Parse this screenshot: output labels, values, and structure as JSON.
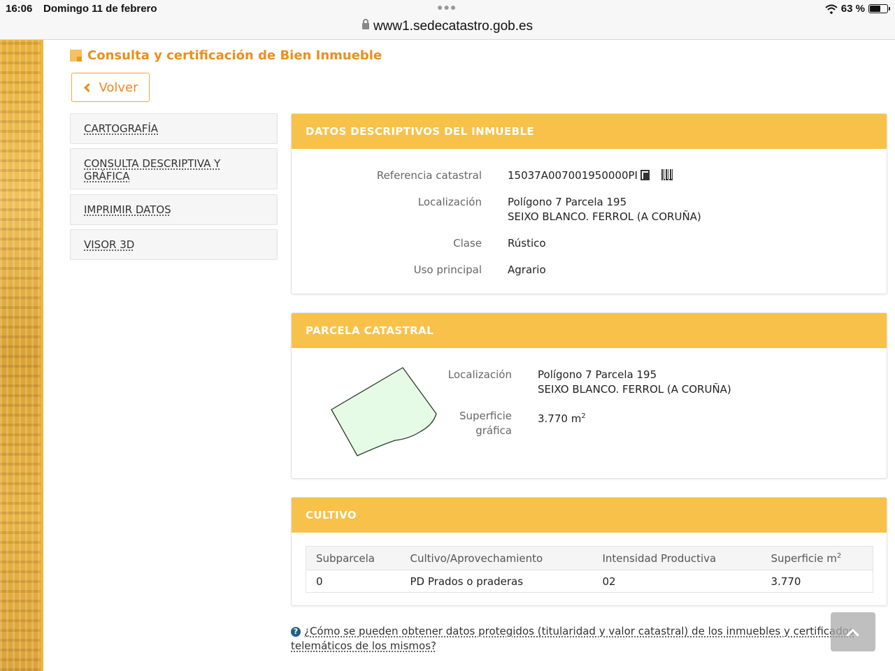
{
  "status_bar": {
    "time": "16:06",
    "date": "Domingo 11 de febrero",
    "battery": "63 %",
    "battery_level": 0.63
  },
  "browser": {
    "url": "www1.sedecatastro.gob.es"
  },
  "page": {
    "title": "Consulta y certificación de Bien Inmueble",
    "back_label": "Volver"
  },
  "sidebar": {
    "items": [
      {
        "label": "CARTOGRAFÍA"
      },
      {
        "label": "CONSULTA DESCRIPTIVA Y GRÁFICA"
      },
      {
        "label": "IMPRIMIR DATOS"
      },
      {
        "label": "VISOR 3D"
      }
    ]
  },
  "datos": {
    "header": "DATOS DESCRIPTIVOS DEL INMUEBLE",
    "ref_label": "Referencia catastral",
    "ref_value": "15037A007001950000PI",
    "loc_label": "Localización",
    "loc_line1": "Polígono 7 Parcela 195",
    "loc_line2": "SEIXO BLANCO. FERROL (A CORUÑA)",
    "clase_label": "Clase",
    "clase_value": "Rústico",
    "uso_label": "Uso principal",
    "uso_value": "Agrario"
  },
  "parcela": {
    "header": "PARCELA CATASTRAL",
    "loc_label": "Localización",
    "loc_line1": "Polígono 7 Parcela 195",
    "loc_line2": "SEIXO BLANCO. FERROL (A CORUÑA)",
    "sup_label_1": "Superficie",
    "sup_label_2": "gráfica",
    "sup_value": "3.770 m",
    "sup_exp": "2",
    "shape_fill": "#e6fbe6",
    "shape_stroke": "#2a3a2a"
  },
  "cultivo": {
    "header": "CULTIVO",
    "columns": [
      "Subparcela",
      "Cultivo/Aprovechamiento",
      "Intensidad Productiva",
      "Superficie m"
    ],
    "col_exp": "2",
    "rows": [
      [
        "0",
        "PD Prados o praderas",
        "02",
        "3.770"
      ]
    ]
  },
  "footer": {
    "help_text": "¿Cómo se pueden obtener datos protegidos (titularidad y valor catastral) de los inmuebles y certificados telemáticos de los mismos?"
  },
  "colors": {
    "accent": "#f8c14a",
    "title": "#ec8f1b",
    "link_icon": "#1f5f8b"
  }
}
